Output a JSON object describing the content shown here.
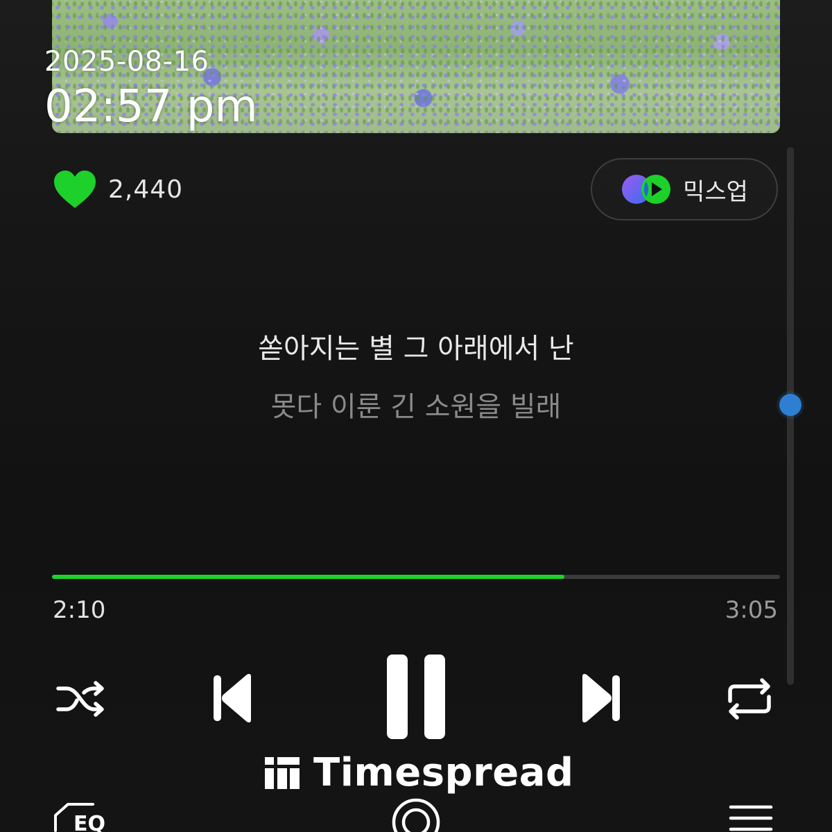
{
  "overlay": {
    "date": "2025-08-16",
    "time": "02:57 pm"
  },
  "album": {
    "description_icon": "album-art"
  },
  "like": {
    "count": "2,440",
    "color": "#1ed12a",
    "icon": "heart-icon"
  },
  "mixup": {
    "label": "믹스업",
    "icon": "mixup-icon"
  },
  "lyrics": {
    "current": "쏟아지는 별 그 아래에서 난",
    "next": "못다 이룬 긴 소원을 빌래"
  },
  "player": {
    "current_time": "2:10",
    "total_time": "3:05",
    "progress": 0.704,
    "accent": "#1ed12a"
  },
  "controls": {
    "shuffle": "shuffle-icon",
    "previous": "previous-icon",
    "pause": "pause-icon",
    "next": "next-icon",
    "repeat": "repeat-icon"
  },
  "bottom_bar": {
    "eq_label": "EQ",
    "scroll_position": 0.48
  },
  "watermark": {
    "text": "Timespread"
  }
}
